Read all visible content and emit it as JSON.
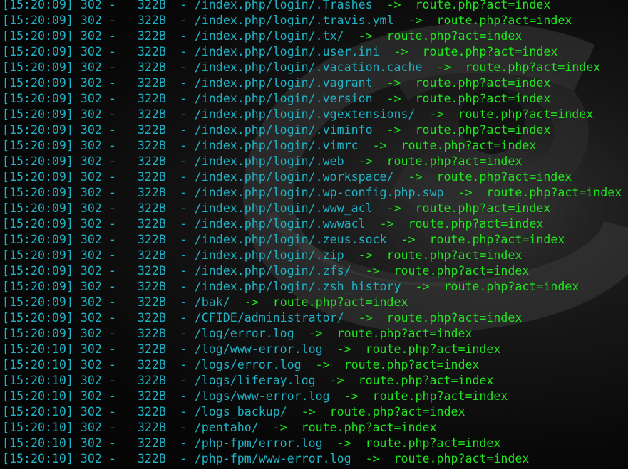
{
  "log_lines": [
    {
      "time": "[15:20:09]",
      "status": "302",
      "size": "322B",
      "path": "/index.php/login/.Trashes",
      "target": "route.php?act=index"
    },
    {
      "time": "[15:20:09]",
      "status": "302",
      "size": "322B",
      "path": "/index.php/login/.travis.yml",
      "target": "route.php?act=index"
    },
    {
      "time": "[15:20:09]",
      "status": "302",
      "size": "322B",
      "path": "/index.php/login/.tx/",
      "target": "route.php?act=index"
    },
    {
      "time": "[15:20:09]",
      "status": "302",
      "size": "322B",
      "path": "/index.php/login/.user.ini",
      "target": "route.php?act=index"
    },
    {
      "time": "[15:20:09]",
      "status": "302",
      "size": "322B",
      "path": "/index.php/login/.vacation.cache",
      "target": "route.php?act=index"
    },
    {
      "time": "[15:20:09]",
      "status": "302",
      "size": "322B",
      "path": "/index.php/login/.vagrant",
      "target": "route.php?act=index"
    },
    {
      "time": "[15:20:09]",
      "status": "302",
      "size": "322B",
      "path": "/index.php/login/.version",
      "target": "route.php?act=index"
    },
    {
      "time": "[15:20:09]",
      "status": "302",
      "size": "322B",
      "path": "/index.php/login/.vgextensions/",
      "target": "route.php?act=index"
    },
    {
      "time": "[15:20:09]",
      "status": "302",
      "size": "322B",
      "path": "/index.php/login/.viminfo",
      "target": "route.php?act=index"
    },
    {
      "time": "[15:20:09]",
      "status": "302",
      "size": "322B",
      "path": "/index.php/login/.vimrc",
      "target": "route.php?act=index"
    },
    {
      "time": "[15:20:09]",
      "status": "302",
      "size": "322B",
      "path": "/index.php/login/.web",
      "target": "route.php?act=index"
    },
    {
      "time": "[15:20:09]",
      "status": "302",
      "size": "322B",
      "path": "/index.php/login/.workspace/",
      "target": "route.php?act=index"
    },
    {
      "time": "[15:20:09]",
      "status": "302",
      "size": "322B",
      "path": "/index.php/login/.wp-config.php.swp",
      "target": "route.php?act=index"
    },
    {
      "time": "[15:20:09]",
      "status": "302",
      "size": "322B",
      "path": "/index.php/login/.www_acl",
      "target": "route.php?act=index"
    },
    {
      "time": "[15:20:09]",
      "status": "302",
      "size": "322B",
      "path": "/index.php/login/.wwwacl",
      "target": "route.php?act=index"
    },
    {
      "time": "[15:20:09]",
      "status": "302",
      "size": "322B",
      "path": "/index.php/login/.zeus.sock",
      "target": "route.php?act=index"
    },
    {
      "time": "[15:20:09]",
      "status": "302",
      "size": "322B",
      "path": "/index.php/login/.zip",
      "target": "route.php?act=index"
    },
    {
      "time": "[15:20:09]",
      "status": "302",
      "size": "322B",
      "path": "/index.php/login/.zfs/",
      "target": "route.php?act=index"
    },
    {
      "time": "[15:20:09]",
      "status": "302",
      "size": "322B",
      "path": "/index.php/login/.zsh_history",
      "target": "route.php?act=index"
    },
    {
      "time": "[15:20:09]",
      "status": "302",
      "size": "322B",
      "path": "/bak/",
      "target": "route.php?act=index"
    },
    {
      "time": "[15:20:09]",
      "status": "302",
      "size": "322B",
      "path": "/CFIDE/administrator/",
      "target": "route.php?act=index"
    },
    {
      "time": "[15:20:09]",
      "status": "302",
      "size": "322B",
      "path": "/log/error.log",
      "target": "route.php?act=index"
    },
    {
      "time": "[15:20:10]",
      "status": "302",
      "size": "322B",
      "path": "/log/www-error.log",
      "target": "route.php?act=index"
    },
    {
      "time": "[15:20:10]",
      "status": "302",
      "size": "322B",
      "path": "/logs/error.log",
      "target": "route.php?act=index"
    },
    {
      "time": "[15:20:10]",
      "status": "302",
      "size": "322B",
      "path": "/logs/liferay.log",
      "target": "route.php?act=index"
    },
    {
      "time": "[15:20:10]",
      "status": "302",
      "size": "322B",
      "path": "/logs/www-error.log",
      "target": "route.php?act=index"
    },
    {
      "time": "[15:20:10]",
      "status": "302",
      "size": "322B",
      "path": "/logs_backup/",
      "target": "route.php?act=index"
    },
    {
      "time": "[15:20:10]",
      "status": "302",
      "size": "322B",
      "path": "/pentaho/",
      "target": "route.php?act=index"
    },
    {
      "time": "[15:20:10]",
      "status": "302",
      "size": "322B",
      "path": "/php-fpm/error.log",
      "target": "route.php?act=index"
    },
    {
      "time": "[15:20:10]",
      "status": "302",
      "size": "322B",
      "path": "/php-fpm/www-error.log",
      "target": "route.php?act=index"
    }
  ],
  "separator": "-",
  "arrow": "->",
  "colors": {
    "log_text": "#1fb2c4",
    "redirect_text": "#21e31f",
    "background": "#050505"
  }
}
